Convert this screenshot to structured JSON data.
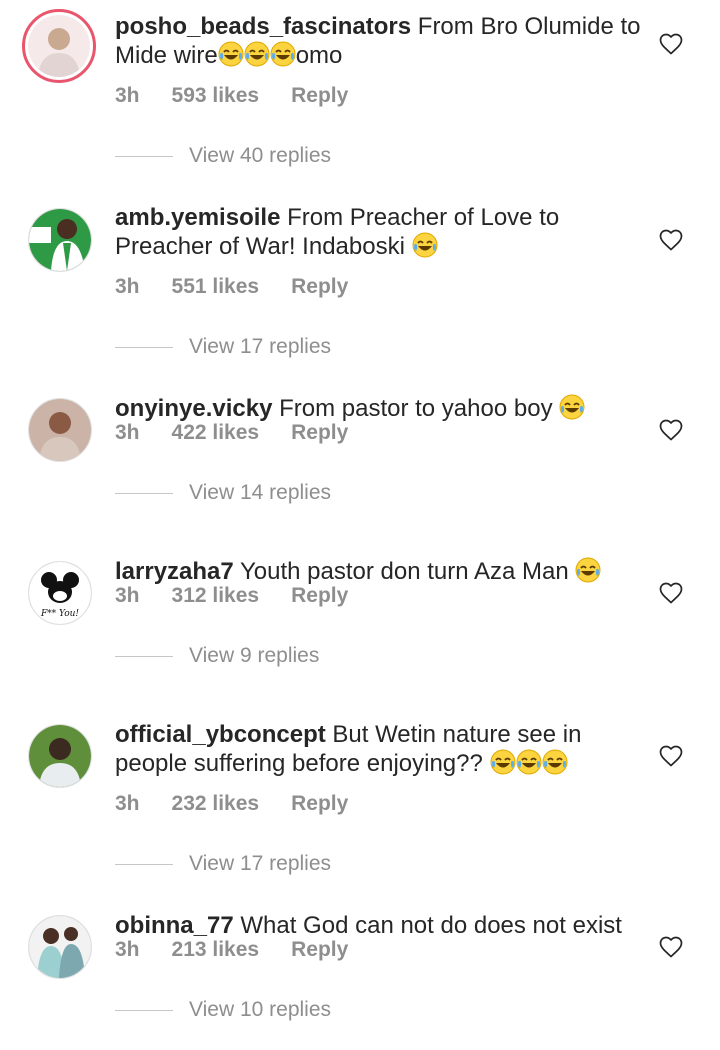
{
  "comments": [
    {
      "username": "posho_beads_fascinators",
      "text": "From Bro Olumide to Mide wire",
      "emojis_mid": 3,
      "text_after": "omo",
      "emojis_end": 0,
      "time": "3h",
      "likes": "593 likes",
      "reply": "Reply",
      "view_replies": "View 40 replies",
      "avatar_icon": "person-photo-icon",
      "has_story": true,
      "avatar_colors": [
        "#f5e9ea",
        "#c9a98f",
        "#e2d4d2"
      ]
    },
    {
      "username": "amb.yemisoile",
      "text": "From Preacher of Love to Preacher of War! Indaboski",
      "emojis_mid": 0,
      "text_after": "",
      "emojis_end": 1,
      "time": "3h",
      "likes": "551 likes",
      "reply": "Reply",
      "view_replies": "View 17 replies",
      "avatar_icon": "campaign-poster-icon",
      "has_story": false,
      "avatar_colors": [
        "#2f9a45",
        "#ffffff",
        "#4a2e21"
      ]
    },
    {
      "username": "onyinye.vicky",
      "text": "From pastor to yahoo boy",
      "emojis_mid": 0,
      "text_after": "",
      "emojis_end": 1,
      "time": "3h",
      "likes": "422 likes",
      "reply": "Reply",
      "view_replies": "View 14 replies",
      "avatar_icon": "person-photo-icon",
      "has_story": false,
      "avatar_colors": [
        "#cbb4a7",
        "#8a5a44",
        "#d8c7bd"
      ]
    },
    {
      "username": "larryzaha7",
      "text": "Youth pastor don turn Aza Man",
      "emojis_mid": 0,
      "text_after": "",
      "emojis_end": 1,
      "time": "3h",
      "likes": "312 likes",
      "reply": "Reply",
      "view_replies": "View 9 replies",
      "avatar_icon": "cartoon-mouse-icon",
      "has_story": false,
      "avatar_colors": [
        "#ffffff",
        "#111111",
        "#ffffff"
      ]
    },
    {
      "username": "official_ybconcept",
      "text": "But Wetin nature see in people suffering before enjoying??",
      "emojis_mid": 0,
      "text_after": "",
      "emojis_end": 3,
      "time": "3h",
      "likes": "232 likes",
      "reply": "Reply",
      "view_replies": "View 17 replies",
      "avatar_icon": "person-photo-icon",
      "has_story": false,
      "avatar_colors": [
        "#5f8f3a",
        "#3b2a20",
        "#e8eef0"
      ]
    },
    {
      "username": "obinna_77",
      "text": "What God can not do does not exist",
      "emojis_mid": 0,
      "text_after": "",
      "emojis_end": 0,
      "time": "3h",
      "likes": "213 likes",
      "reply": "Reply",
      "view_replies": "View 10 replies",
      "avatar_icon": "couple-photo-icon",
      "has_story": false,
      "avatar_colors": [
        "#9ccfcf",
        "#4a3024",
        "#7da8b0"
      ]
    }
  ]
}
